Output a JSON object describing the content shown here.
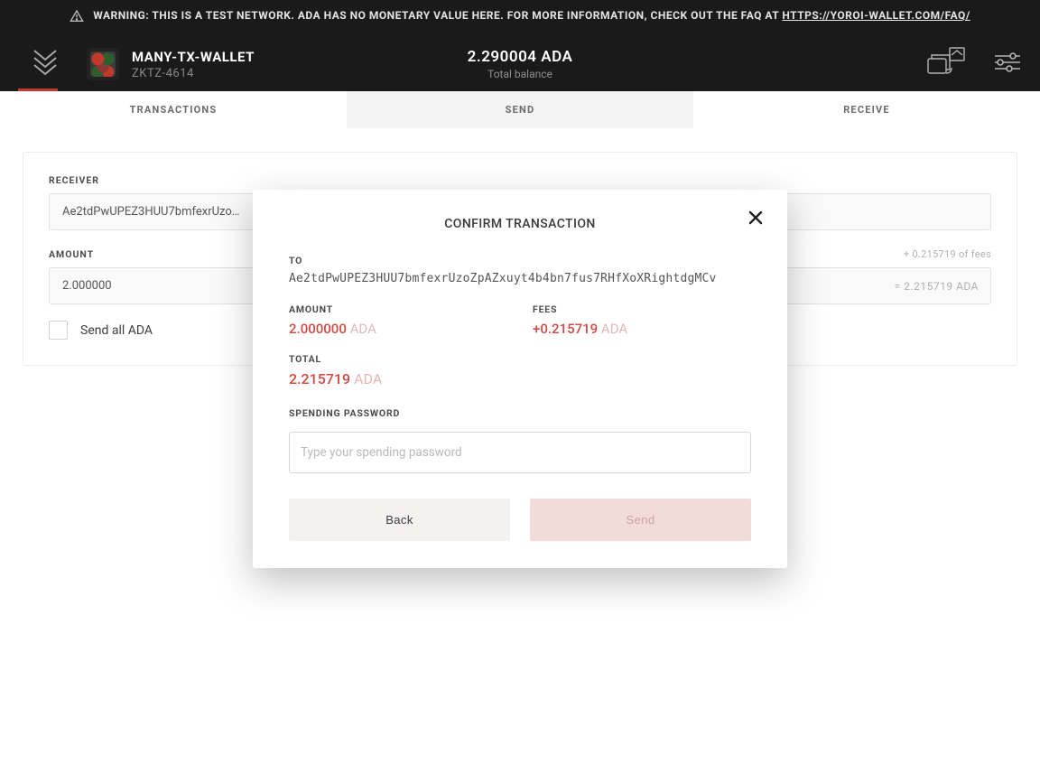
{
  "warning": {
    "prefix": "WARNING: THIS IS A TEST NETWORK. ADA HAS NO MONETARY VALUE HERE. FOR MORE INFORMATION, CHECK OUT THE FAQ AT ",
    "link_text": "HTTPS://YOROI-WALLET.COM/FAQ/"
  },
  "header": {
    "wallet_name": "MANY-TX-WALLET",
    "wallet_sub": "ZKTZ-4614",
    "balance_value": "2.290004 ADA",
    "balance_label": "Total balance"
  },
  "tabs": {
    "transactions": "TRANSACTIONS",
    "send": "SEND",
    "receive": "RECEIVE"
  },
  "form": {
    "receiver_label": "RECEIVER",
    "receiver_value": "Ae2tdPwUPEZ3HUU7bmfexrUzo…",
    "amount_label": "AMOUNT",
    "amount_value": "2.000000",
    "fee_hint": "+ 0.215719 of fees",
    "total_hint": "= 2.215719 ADA",
    "send_all_label": "Send all ADA"
  },
  "modal": {
    "title": "CONFIRM TRANSACTION",
    "to_label": "TO",
    "to_value": "Ae2tdPwUPEZ3HUU7bmfexrUzoZpAZxuyt4b4bn7fus7RHfXoXRightdgMCv",
    "amount_label": "AMOUNT",
    "amount_value": "2.000000",
    "amount_unit": "ADA",
    "fees_label": "FEES",
    "fees_value": "+0.215719",
    "fees_unit": "ADA",
    "total_label": "TOTAL",
    "total_value": "2.215719",
    "total_unit": "ADA",
    "password_label": "SPENDING PASSWORD",
    "password_placeholder": "Type your spending password",
    "back_label": "Back",
    "send_label": "Send"
  }
}
